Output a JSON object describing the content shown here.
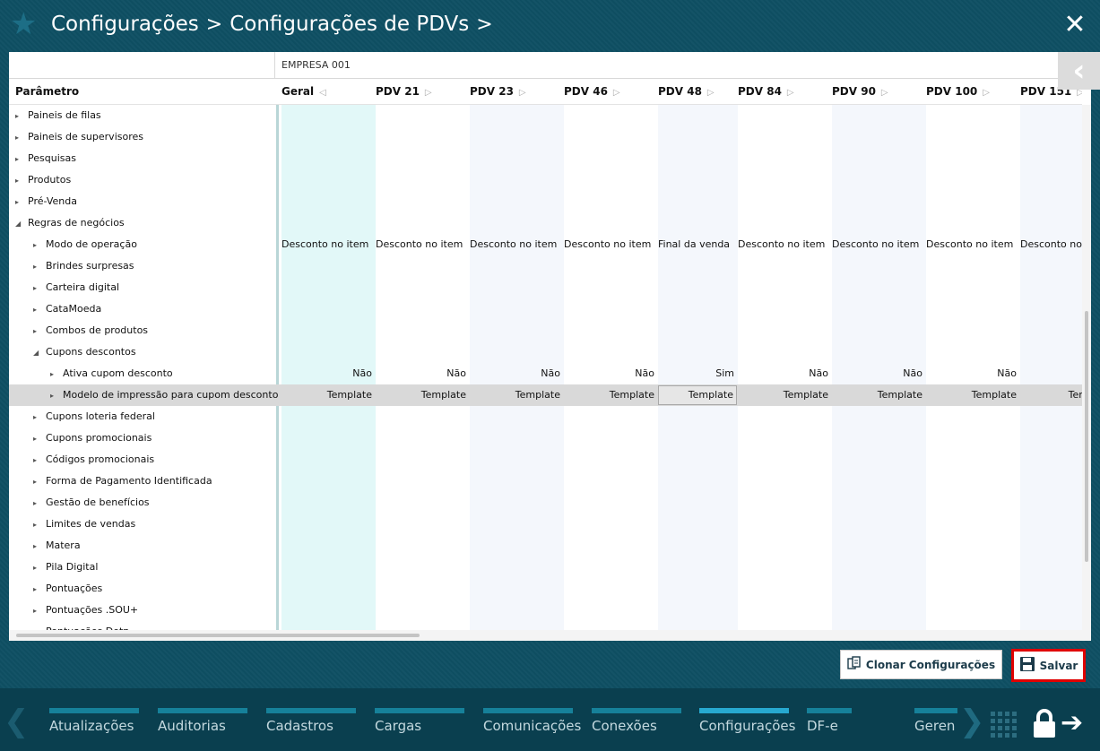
{
  "header": {
    "breadcrumb": [
      "Configurações",
      "Configurações de PDVs"
    ],
    "separator": ">",
    "star_icon": "star-icon",
    "close_icon": "close-icon"
  },
  "grid": {
    "company": "EMPRESA 001",
    "param_header": "Parâmetro",
    "columns": [
      "Geral",
      "PDV 21",
      "PDV 23",
      "PDV 46",
      "PDV 48",
      "PDV 84",
      "PDV 90",
      "PDV 100",
      "PDV 151"
    ],
    "tree": [
      {
        "label": "Paineis de filas",
        "expanded": false
      },
      {
        "label": "Paineis de supervisores",
        "expanded": false
      },
      {
        "label": "Pesquisas",
        "expanded": false
      },
      {
        "label": "Produtos",
        "expanded": false
      },
      {
        "label": "Pré-Venda",
        "expanded": false
      },
      {
        "label": "Regras de negócios",
        "expanded": true
      },
      {
        "label": "Modo de operação",
        "expanded": false,
        "values": [
          "Desconto no item",
          "Desconto no item",
          "Desconto no item",
          "Desconto no item",
          "Final da venda",
          "Desconto no item",
          "Desconto no item",
          "Desconto no item",
          "Desconto no"
        ]
      },
      {
        "label": "Brindes surpresas",
        "expanded": false
      },
      {
        "label": "Carteira digital",
        "expanded": false
      },
      {
        "label": "CataMoeda",
        "expanded": false
      },
      {
        "label": "Combos de produtos",
        "expanded": false
      },
      {
        "label": "Cupons descontos",
        "expanded": true
      },
      {
        "label": "Ativa cupom desconto",
        "expanded": false,
        "values": [
          "Não",
          "Não",
          "Não",
          "Não",
          "Sim",
          "Não",
          "Não",
          "Não",
          ""
        ]
      },
      {
        "label": "Modelo de impressão para cupom desconto",
        "expanded": false,
        "values": [
          "Template",
          "Template",
          "Template",
          "Template",
          "Template",
          "Template",
          "Template",
          "Template",
          "Tem"
        ]
      },
      {
        "label": "Cupons loteria federal",
        "expanded": false
      },
      {
        "label": "Cupons promocionais",
        "expanded": false
      },
      {
        "label": "Códigos promocionais",
        "expanded": false
      },
      {
        "label": "Forma de Pagamento Identificada",
        "expanded": false
      },
      {
        "label": "Gestão de benefícios",
        "expanded": false
      },
      {
        "label": "Limites de vendas",
        "expanded": false
      },
      {
        "label": "Matera",
        "expanded": false
      },
      {
        "label": "Pila Digital",
        "expanded": false
      },
      {
        "label": "Pontuações",
        "expanded": false
      },
      {
        "label": "Pontuações .SOU+",
        "expanded": false
      },
      {
        "label": "Pontuações Dotz",
        "expanded": false
      }
    ],
    "selected_row": "Modelo de impressão para cupom desconto",
    "selected_cell_column": "PDV 48"
  },
  "actions": {
    "clone_label": "Clonar Configurações",
    "save_label": "Salvar"
  },
  "nav": {
    "items": [
      "Atualizações",
      "Auditorias",
      "Cadastros",
      "Cargas",
      "Comunicações",
      "Conexões",
      "Configurações",
      "DF-e",
      "Geren"
    ],
    "active": "Configurações"
  },
  "colors": {
    "background": "#0e4f63",
    "geral_column": "#e2f8f8",
    "alt_column": "#f4f7fc",
    "save_border": "#e00000",
    "nav_bar": "#16819a",
    "nav_bar_active": "#27a9d0"
  }
}
